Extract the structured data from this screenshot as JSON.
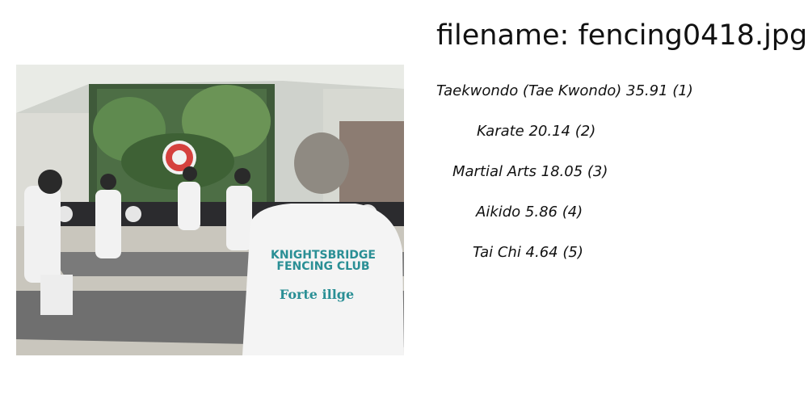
{
  "filename_text": "filename: fencing0418.jpg",
  "photo": {
    "shirt_text_line1": "KNIGHTSBRIDGE",
    "shirt_text_line2": "FENCING CLUB",
    "shirt_text_line3": "Forte illge"
  },
  "predictions": [
    {
      "text": "Taekwondo (Tae Kwondo) 35.91 (1)"
    },
    {
      "text": "Karate 20.14 (2)"
    },
    {
      "text": "Martial Arts 18.05 (3)"
    },
    {
      "text": "Aikido  5.86 (4)"
    },
    {
      "text": "Tai Chi  4.64 (5)"
    }
  ]
}
